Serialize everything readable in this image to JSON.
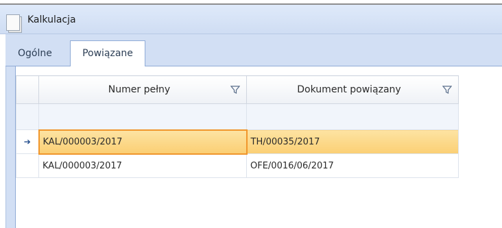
{
  "window": {
    "title": "Kalkulacja"
  },
  "tabs": [
    {
      "label": "Ogólne",
      "active": false
    },
    {
      "label": "Powiązane",
      "active": true
    }
  ],
  "grid": {
    "columns": [
      "Numer pełny",
      "Dokument powiązany"
    ],
    "current_row_marker": "➔",
    "rows": [
      {
        "numer": "KAL/000003/2017",
        "dokument": "TH/00035/2017",
        "selected": true
      },
      {
        "numer": "KAL/000003/2017",
        "dokument": "OFE/0016/06/2017",
        "selected": false
      }
    ]
  },
  "colors": {
    "selection": "#fbcf74",
    "focus_border": "#f0962c",
    "header_bg": "#d2dff4"
  }
}
